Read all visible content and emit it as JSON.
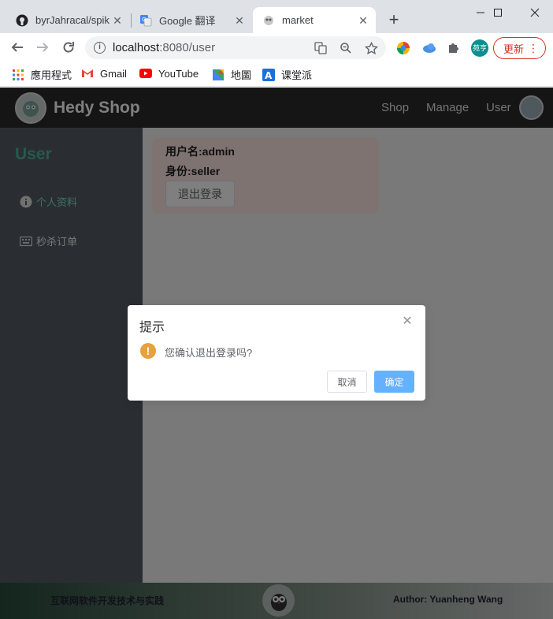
{
  "browser": {
    "tabs": [
      {
        "title": "byrJahracal/spik",
        "icon": "github-icon"
      },
      {
        "title": "Google 翻译",
        "icon": "google-translate-icon"
      },
      {
        "title": "market",
        "icon": "market-favicon"
      }
    ],
    "url_host": "localhost",
    "url_port_path": ":8080/user",
    "profile_label": "苑亨",
    "update_label": "更新",
    "bookmarks": [
      {
        "label": "應用程式",
        "icon": "apps-grid-icon"
      },
      {
        "label": "Gmail",
        "icon": "gmail-icon"
      },
      {
        "label": "YouTube",
        "icon": "youtube-icon"
      },
      {
        "label": "地圖",
        "icon": "maps-icon"
      },
      {
        "label": "课堂派",
        "icon": "ketangpai-icon"
      }
    ]
  },
  "site": {
    "brand": "Hedy Shop",
    "nav": [
      {
        "label": "Shop"
      },
      {
        "label": "Manage"
      },
      {
        "label": "User"
      }
    ],
    "sidebar": {
      "title": "User",
      "items": [
        {
          "label": "个人资料",
          "icon": "info-icon",
          "active": true
        },
        {
          "label": "秒杀订单",
          "icon": "keyboard-icon",
          "active": false
        }
      ]
    },
    "profile": {
      "username_line": "用户名:admin",
      "role_line": "身份:seller",
      "logout_button": "退出登录"
    },
    "footer": {
      "left_text": "互联网软件开发技术与实践",
      "right_text": "Author: Yuanheng Wang"
    }
  },
  "dialog": {
    "title": "提示",
    "message": "您确认退出登录吗?",
    "cancel_label": "取消",
    "confirm_label": "确定"
  },
  "colors": {
    "accent": "#4db397",
    "warning": "#e6a23c",
    "primary_button": "#66b1ff"
  }
}
